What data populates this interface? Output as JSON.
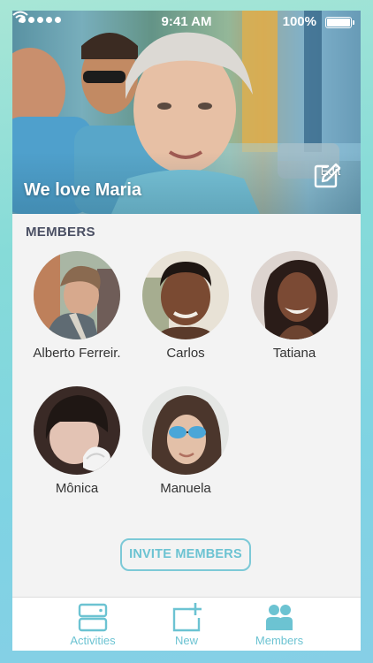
{
  "status_bar": {
    "time": "9:41 AM",
    "battery": "100%"
  },
  "hero": {
    "title": "We love Maria",
    "edit_label": "Edit",
    "edit_icon": "pencil-square-icon"
  },
  "members": {
    "section_title": "MEMBERS",
    "items": [
      {
        "name": "Alberto Ferreir."
      },
      {
        "name": "Carlos"
      },
      {
        "name": "Tatiana"
      },
      {
        "name": "Mônica"
      },
      {
        "name": "Manuela"
      }
    ],
    "invite_label": "INVITE MEMBERS"
  },
  "tabbar": {
    "tabs": [
      {
        "label": "Activities",
        "icon": "activities-icon"
      },
      {
        "label": "New",
        "icon": "new-icon"
      },
      {
        "label": "Members",
        "icon": "members-icon"
      }
    ]
  },
  "colors": {
    "accent": "#6cc3d2",
    "section_title": "#4a4f63",
    "background": "#f3f3f3"
  }
}
